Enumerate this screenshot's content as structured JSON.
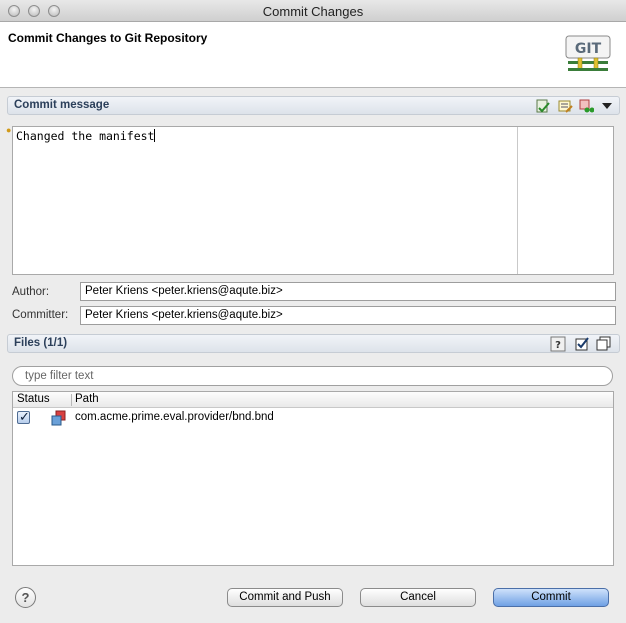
{
  "window": {
    "title": "Commit Changes"
  },
  "header": {
    "title": "Commit Changes to Git Repository",
    "logo_text": "GIT"
  },
  "commit_message": {
    "section_title": "Commit message",
    "text": "Changed the manifest"
  },
  "author": {
    "label": "Author:",
    "value": "Peter Kriens <peter.kriens@aqute.biz>"
  },
  "committer": {
    "label": "Committer:",
    "value": "Peter Kriens <peter.kriens@aqute.biz>"
  },
  "files": {
    "section_title": "Files (1/1)",
    "filter_placeholder": "type filter text",
    "columns": [
      "Status",
      "Path"
    ],
    "rows": [
      {
        "checked": true,
        "path": "com.acme.prime.eval.provider/bnd.bnd"
      }
    ]
  },
  "buttons": {
    "help": "?",
    "commit_and_push": "Commit and Push",
    "cancel": "Cancel",
    "commit": "Commit"
  },
  "colors": {
    "accent": "#6fa0e4",
    "section_title": "#2b3f5a"
  }
}
